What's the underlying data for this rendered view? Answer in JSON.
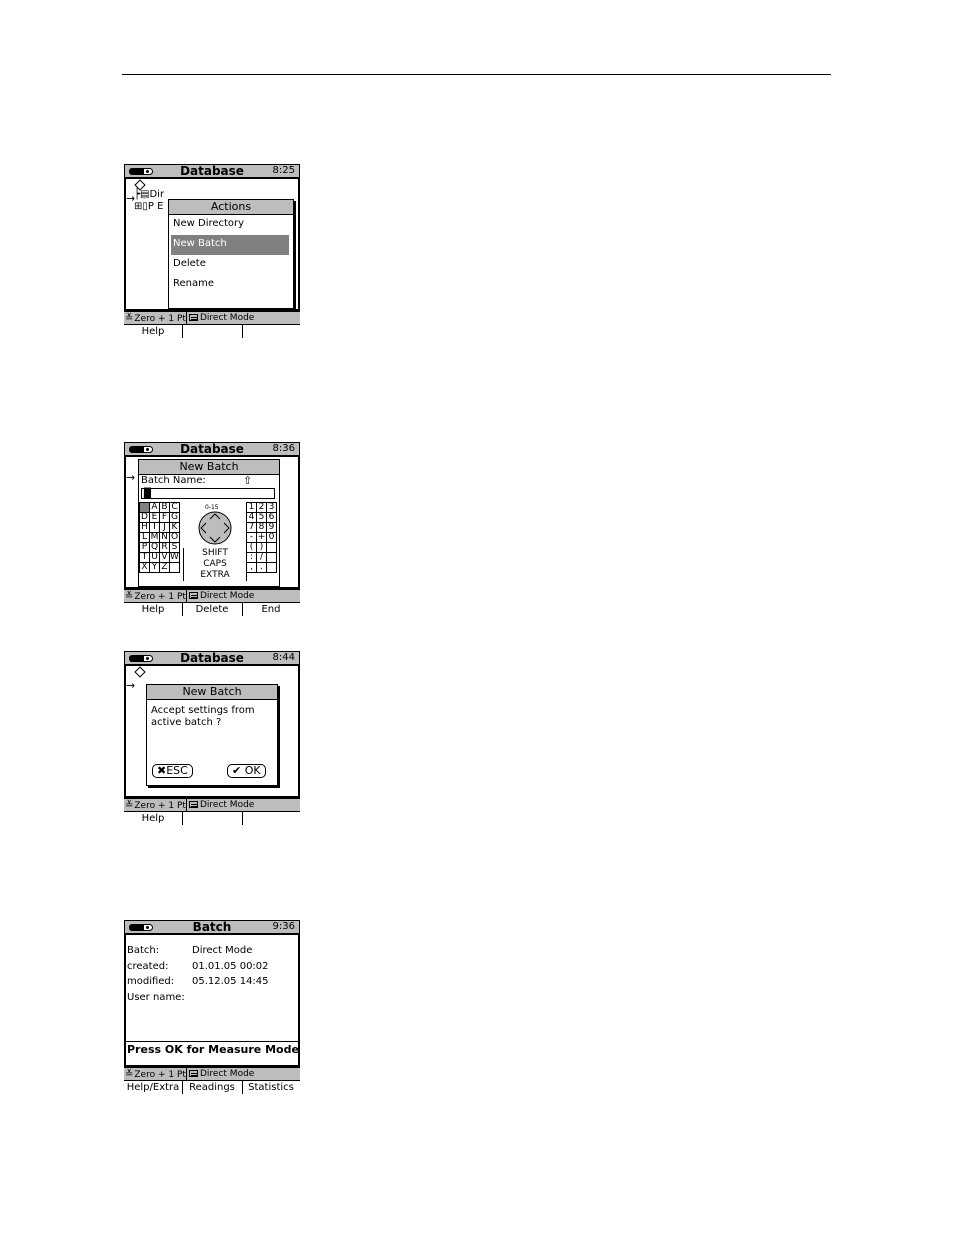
{
  "screen1": {
    "title": "Database",
    "time": "8:25",
    "tree_line1": "Dir",
    "tree_line2": "P E",
    "dialog_title": "Actions",
    "menu": [
      "New Directory",
      "New Batch",
      "Delete",
      "Rename"
    ],
    "status_left": "Zero + 1 Pt",
    "status_right": "Direct Mode",
    "softkeys": [
      "Help",
      "",
      ""
    ]
  },
  "screen2": {
    "title": "Database",
    "time": "8:36",
    "dialog_title": "New Batch",
    "field_label": "Batch Name:",
    "shift_arrow": "⇧",
    "cursor": "█",
    "letters": [
      [
        "",
        "A",
        "B",
        "C"
      ],
      [
        "D",
        "E",
        "F",
        "G"
      ],
      [
        "H",
        "I",
        "J",
        "K"
      ],
      [
        "L",
        "M",
        "N",
        "O"
      ],
      [
        "P",
        "Q",
        "R",
        "S"
      ],
      [
        "T",
        "U",
        "V",
        "W"
      ],
      [
        "X",
        "Y",
        "Z",
        ""
      ]
    ],
    "range_label": "0-15",
    "words": [
      "SHIFT",
      "CAPS",
      "EXTRA"
    ],
    "digits": [
      [
        "1",
        "2",
        "3"
      ],
      [
        "4",
        "5",
        "6"
      ],
      [
        "7",
        "8",
        "9"
      ],
      [
        "-",
        "+",
        "0"
      ],
      [
        "(",
        ")",
        ""
      ],
      [
        ":",
        "/",
        ""
      ],
      [
        ",",
        ".",
        ""
      ]
    ],
    "status_left": "Zero + 1 Pt",
    "status_right": "Direct Mode",
    "softkeys": [
      "Help",
      "Delete",
      "End"
    ]
  },
  "screen3": {
    "title": "Database",
    "time": "8:44",
    "dialog_title": "New Batch",
    "message_line1": "Accept settings from",
    "message_line2": "active batch ?",
    "esc_label": "ESC",
    "ok_label": "OK",
    "status_left": "Zero + 1 Pt",
    "status_right": "Direct Mode",
    "softkeys": [
      "Help",
      "",
      ""
    ]
  },
  "screen4": {
    "title": "Batch",
    "time": "9:36",
    "rows": [
      {
        "label": "Batch:",
        "value": "Direct Mode"
      },
      {
        "label": "created:",
        "value": "01.01.05 00:02"
      },
      {
        "label": "modified:",
        "value": "05.12.05 14:45"
      },
      {
        "label": "User name:",
        "value": ""
      }
    ],
    "prompt": "Press OK for Measure Mode",
    "status_left": "Zero + 1 Pt",
    "status_right": "Direct Mode",
    "softkeys": [
      "Help/Extra",
      "Readings",
      "Statistics"
    ]
  }
}
